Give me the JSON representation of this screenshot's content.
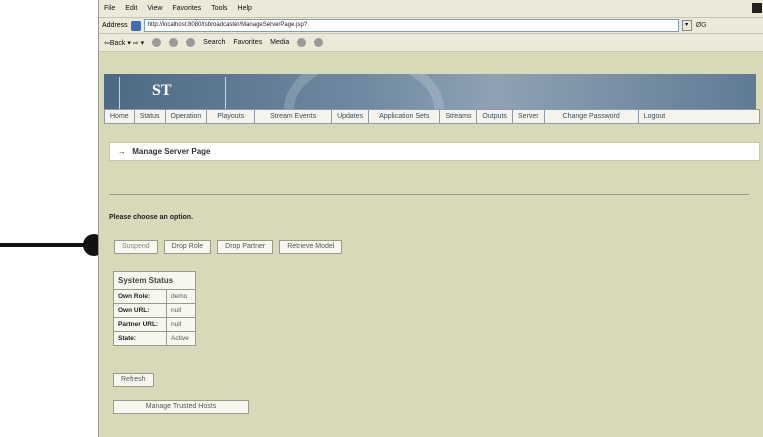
{
  "browser": {
    "menu": [
      "File",
      "Edit",
      "View",
      "Favorites",
      "Tools",
      "Help"
    ],
    "address_label": "Address",
    "address_value": "http://localhost:8080/tsbroadcaster/ManageServerPage.jsp?",
    "go_label": "ØG",
    "toolbar": [
      "⇦Back ▾ ⇨ ▾",
      "Search",
      "Favorites",
      "Media"
    ]
  },
  "banner": {
    "logo": "ST"
  },
  "nav": [
    "Home",
    "Status",
    "Operation",
    "Playouts",
    "Stream Events",
    "Updates",
    "Application Sets",
    "Streams",
    "Outputs",
    "Server",
    "Change Password",
    "Logout"
  ],
  "page": {
    "title_arrow": "→",
    "title": "Manage Server Page",
    "prompt": "Please choose an option.",
    "buttons": [
      "Suspend",
      "Drop Role",
      "Drop Partner",
      "Retrieve Model"
    ]
  },
  "status": {
    "header": "System Status",
    "rows": [
      {
        "label": "Own Role:",
        "value": "demo"
      },
      {
        "label": "Own URL:",
        "value": "null"
      },
      {
        "label": "Partner URL:",
        "value": "null"
      },
      {
        "label": "State:",
        "value": "Active"
      }
    ]
  },
  "actions": {
    "refresh": "Refresh",
    "manage_hosts": "Manage Trusted Hosts"
  }
}
